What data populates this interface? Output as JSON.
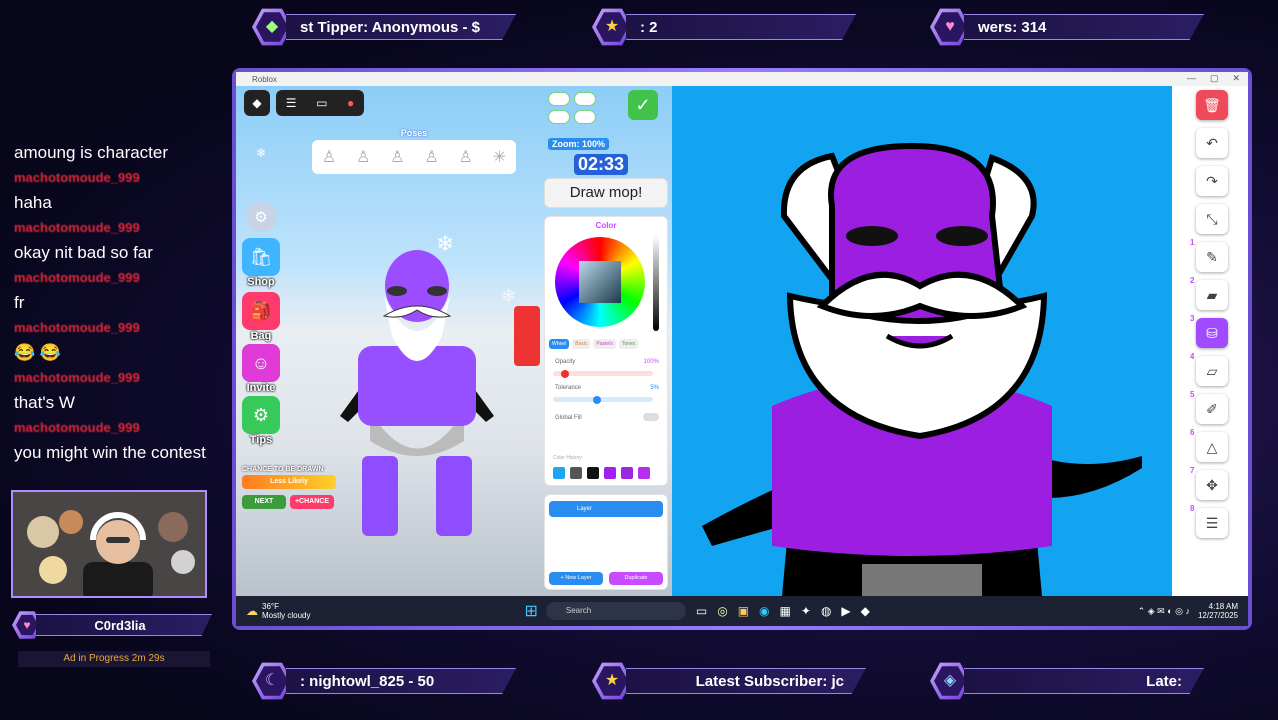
{
  "overlay": {
    "tickers_top": [
      {
        "icon": "tip-icon",
        "glyph": "◆",
        "text": "st Tipper: Anonymous - $"
      },
      {
        "icon": "star-icon",
        "glyph": "★",
        "text": ": 2"
      },
      {
        "icon": "heart-icon",
        "glyph": "♥",
        "text": "wers: 314"
      }
    ],
    "tickers_bottom": [
      {
        "icon": "moon-icon",
        "glyph": "☾",
        "text": ": nightowl_825 - 50"
      },
      {
        "icon": "star-icon",
        "glyph": "★",
        "text": "Latest Subscriber: jc"
      },
      {
        "icon": "gem-icon",
        "glyph": "◈",
        "text": "Late:"
      }
    ],
    "streamer_name": "C0rd3lia",
    "ad_status": "Ad in Progress  2m 29s"
  },
  "chat": {
    "messages": [
      {
        "user": "",
        "text": "amoung is character"
      },
      {
        "user": "machotomoude_999",
        "text": "haha"
      },
      {
        "user": "machotomoude_999",
        "text": "okay nit bad so far"
      },
      {
        "user": "machotomoude_999",
        "text": "fr"
      },
      {
        "user": "machotomoude_999",
        "text": "😂 😂"
      },
      {
        "user": "machotomoude_999",
        "text": "that's W"
      },
      {
        "user": "machotomoude_999",
        "text": "you might win the contest"
      }
    ]
  },
  "window": {
    "title": "Roblox"
  },
  "game": {
    "poses_label": "Poses",
    "sidebar": [
      {
        "name": "settings",
        "label": "",
        "color": "#b9c6d8",
        "glyph": "⚙"
      },
      {
        "name": "shop",
        "label": "Shop",
        "color": "#3fb4ff",
        "glyph": "🛍"
      },
      {
        "name": "bag",
        "label": "Bag",
        "color": "#ff3b6b",
        "glyph": "🎒"
      },
      {
        "name": "invite",
        "label": "Invite",
        "color": "#e03bd6",
        "glyph": "☺"
      },
      {
        "name": "tips",
        "label": "Tips",
        "color": "#37c95a",
        "glyph": "⚙"
      }
    ],
    "chance_label": "CHANCE TO BE DRAWN",
    "chance_level": "Less Likely",
    "next_label": "NEXT",
    "chance_btn": "+CHANCE"
  },
  "drawing_tools": {
    "zoom_label": "Zoom:",
    "zoom_value": "100%",
    "timer": "02:33",
    "prompt": "Draw mop!",
    "color_title": "Color",
    "color_tabs": [
      "Wheel",
      "Basic",
      "Pastels",
      "Tones"
    ],
    "opacity_label": "Opacity",
    "opacity_value": "100%",
    "tolerance_label": "Tolerance",
    "tolerance_value": "5%",
    "global_fill_label": "Global Fill",
    "color_history_label": "Color History",
    "history_colors": [
      "#1ea6f2",
      "#555555",
      "#111111",
      "#a020f0",
      "#9c27e0",
      "#b62ef0"
    ],
    "layer_label": "Layer",
    "new_layer": "+ New Layer",
    "duplicate": "Duplicate"
  },
  "right_tools": [
    {
      "n": "",
      "icon": "trash-icon",
      "glyph": "🗑"
    },
    {
      "n": "",
      "icon": "undo-icon",
      "glyph": "↶"
    },
    {
      "n": "",
      "icon": "redo-icon",
      "glyph": "↷"
    },
    {
      "n": "",
      "icon": "shrink-icon",
      "glyph": "⤡"
    },
    {
      "n": "1",
      "icon": "pencil-icon",
      "glyph": "✎"
    },
    {
      "n": "2",
      "icon": "eraser-icon",
      "glyph": "▰"
    },
    {
      "n": "3",
      "icon": "bucket-icon",
      "glyph": "⛁"
    },
    {
      "n": "4",
      "icon": "ruler-icon",
      "glyph": "▱"
    },
    {
      "n": "5",
      "icon": "picker-icon",
      "glyph": "✐"
    },
    {
      "n": "6",
      "icon": "shapes-icon",
      "glyph": "△"
    },
    {
      "n": "7",
      "icon": "move-icon",
      "glyph": "✥"
    },
    {
      "n": "8",
      "icon": "layers-icon",
      "glyph": "☰"
    }
  ],
  "taskbar": {
    "temp": "36°F",
    "weather": "Mostly cloudy",
    "search": "Search",
    "time": "4:18 AM",
    "date": "12/27/2025"
  },
  "colors": {
    "canvas_bg": "#12a4f0",
    "purple": "#9c1ee0",
    "accent": "#a04bff"
  }
}
